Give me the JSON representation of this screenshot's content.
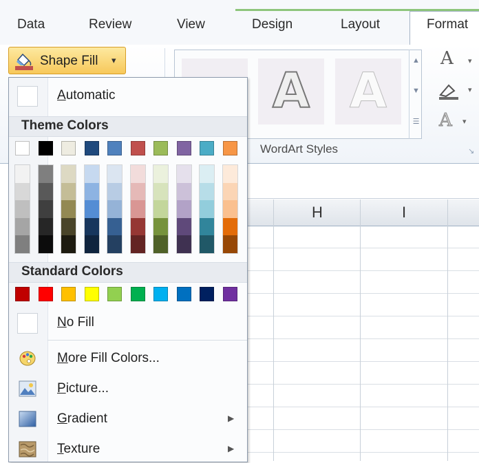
{
  "ribbon": {
    "tabs": [
      "Data",
      "Review",
      "View",
      "Design",
      "Layout",
      "Format"
    ],
    "shape_fill_label": "Shape Fill",
    "group_label": "WordArt Styles",
    "wordart_letter": "A"
  },
  "sheet": {
    "columns": [
      "H",
      "I"
    ]
  },
  "menu": {
    "automatic": {
      "accel": "A",
      "rest": "utomatic"
    },
    "theme_colors_label": "Theme Colors",
    "standard_colors_label": "Standard Colors",
    "no_fill": {
      "accel": "N",
      "rest": "o Fill"
    },
    "more_fill": {
      "accel": "M",
      "rest": "ore Fill Colors..."
    },
    "picture": {
      "accel": "P",
      "rest": "icture..."
    },
    "gradient": {
      "accel": "G",
      "rest": "radient"
    },
    "texture": {
      "accel": "T",
      "rest": "exture"
    },
    "theme_top": [
      "#ffffff",
      "#000000",
      "#eeece1",
      "#1f497d",
      "#4f81bd",
      "#c0504d",
      "#9bbb59",
      "#8064a2",
      "#4bacc6",
      "#f79646"
    ],
    "theme_shades": [
      [
        "#f2f2f2",
        "#d8d8d8",
        "#bfbfbf",
        "#a5a5a5",
        "#7f7f7f"
      ],
      [
        "#7f7f7f",
        "#595959",
        "#3f3f3f",
        "#262626",
        "#0c0c0c"
      ],
      [
        "#ddd9c3",
        "#c4bd97",
        "#938953",
        "#494429",
        "#1d1b10"
      ],
      [
        "#c6d9f0",
        "#8db3e2",
        "#548dd4",
        "#17365d",
        "#0f243e"
      ],
      [
        "#dbe5f1",
        "#b8cce4",
        "#95b3d7",
        "#366092",
        "#244061"
      ],
      [
        "#f2dcdb",
        "#e5b9b7",
        "#d99694",
        "#953734",
        "#632423"
      ],
      [
        "#ebf1dd",
        "#d7e3bc",
        "#c3d69b",
        "#76923c",
        "#4f6128"
      ],
      [
        "#e5e0ec",
        "#ccc1d9",
        "#b2a2c7",
        "#5f497a",
        "#3f3151"
      ],
      [
        "#dbeef3",
        "#b7dde8",
        "#92cddc",
        "#31859b",
        "#205867"
      ],
      [
        "#fdeada",
        "#fbd5b5",
        "#fac08f",
        "#e36c09",
        "#974806"
      ]
    ],
    "standard": [
      "#c00000",
      "#ff0000",
      "#ffc000",
      "#ffff00",
      "#92d050",
      "#00b050",
      "#00b0f0",
      "#0070c0",
      "#002060",
      "#7030a0"
    ]
  }
}
